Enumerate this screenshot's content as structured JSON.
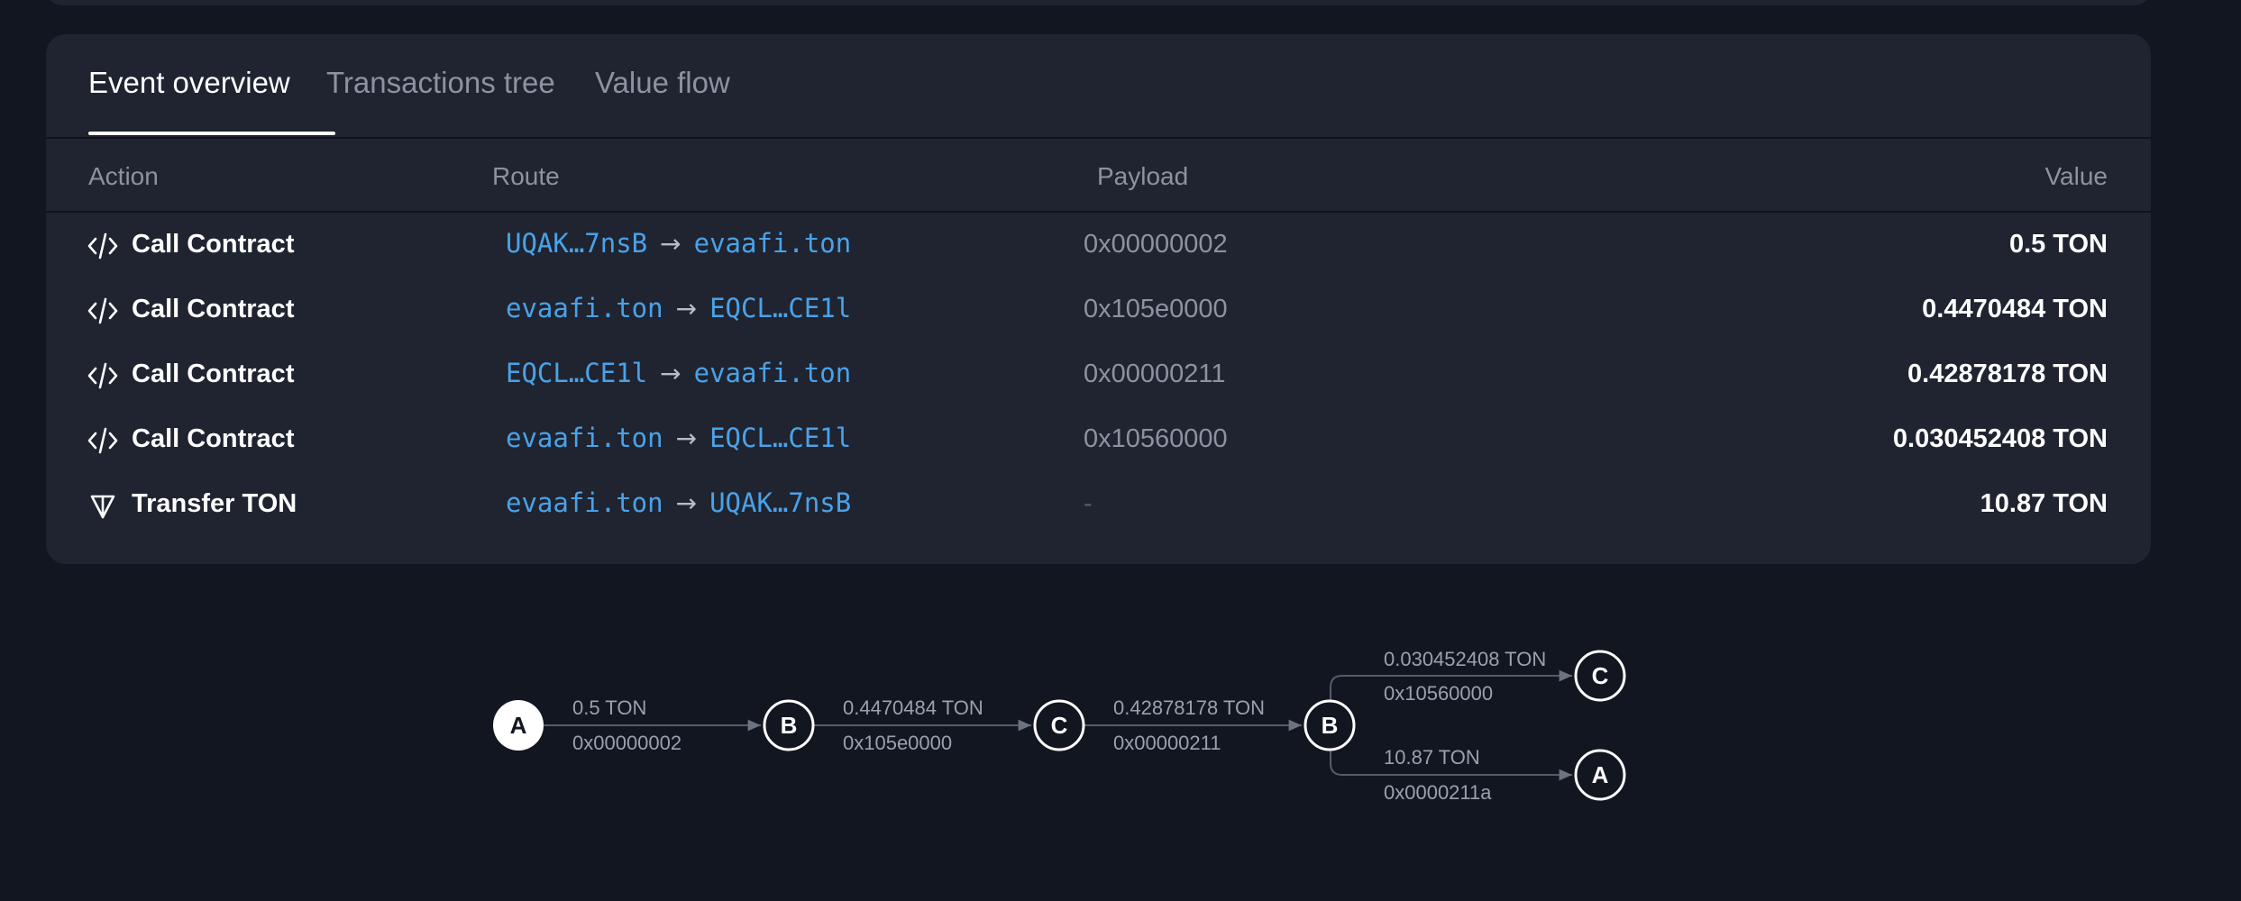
{
  "tabs": [
    {
      "label": "Event overview",
      "active": true
    },
    {
      "label": "Transactions tree",
      "active": false
    },
    {
      "label": "Value flow",
      "active": false
    }
  ],
  "table": {
    "headers": {
      "action": "Action",
      "route": "Route",
      "payload": "Payload",
      "value": "Value"
    },
    "rows": [
      {
        "icon": "code-icon",
        "action": "Call Contract",
        "from": "UQAK…7nsB",
        "arrow": "→",
        "to": "evaafi.ton",
        "payload": "0x00000002",
        "value": "0.5 TON"
      },
      {
        "icon": "code-icon",
        "action": "Call Contract",
        "from": "evaafi.ton",
        "arrow": "→",
        "to": "EQCL…CE1l",
        "payload": "0x105e0000",
        "value": "0.4470484 TON"
      },
      {
        "icon": "code-icon",
        "action": "Call Contract",
        "from": "EQCL…CE1l",
        "arrow": "→",
        "to": "evaafi.ton",
        "payload": "0x00000211",
        "value": "0.42878178 TON"
      },
      {
        "icon": "code-icon",
        "action": "Call Contract",
        "from": "evaafi.ton",
        "arrow": "→",
        "to": "EQCL…CE1l",
        "payload": "0x10560000",
        "value": "0.030452408 TON"
      },
      {
        "icon": "ton-icon",
        "action": "Transfer TON",
        "from": "evaafi.ton",
        "arrow": "→",
        "to": "UQAK…7nsB",
        "payload": "-",
        "value": "10.87 TON"
      }
    ]
  },
  "flow": {
    "nodes": [
      "A",
      "B",
      "C",
      "B",
      "C",
      "A"
    ],
    "edges": [
      {
        "amount": "0.5 TON",
        "payload": "0x00000002"
      },
      {
        "amount": "0.4470484 TON",
        "payload": "0x105e0000"
      },
      {
        "amount": "0.42878178 TON",
        "payload": "0x00000211"
      },
      {
        "amount": "0.030452408 TON",
        "payload": "0x10560000"
      },
      {
        "amount": "10.87 TON",
        "payload": "0x0000211a"
      }
    ]
  },
  "colors": {
    "background": "#121620",
    "card": "#1f2430",
    "link": "#4aa2e8",
    "muted": "#8c93a0"
  }
}
